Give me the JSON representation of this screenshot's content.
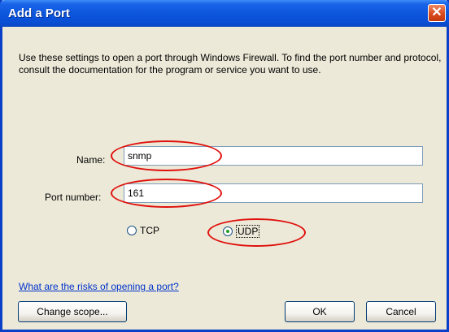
{
  "window": {
    "title": "Add a Port",
    "close_glyph": "✕"
  },
  "description": "Use these settings to open a port through Windows Firewall. To find the port number and protocol, consult the documentation for the program or service you want to use.",
  "name_field": {
    "label": "Name:",
    "value": "snmp"
  },
  "port_field": {
    "label": "Port number:",
    "value": "161"
  },
  "protocol": {
    "tcp_label": "TCP",
    "udp_label": "UDP",
    "selected": "UDP"
  },
  "risks_link": "What are the risks of opening a port?",
  "buttons": {
    "change_scope": "Change scope...",
    "ok": "OK",
    "cancel": "Cancel"
  },
  "colors": {
    "title_bar": "#0a4fd6",
    "highlight_ring": "#e0100c",
    "dialog_bg": "#ece9d8"
  }
}
